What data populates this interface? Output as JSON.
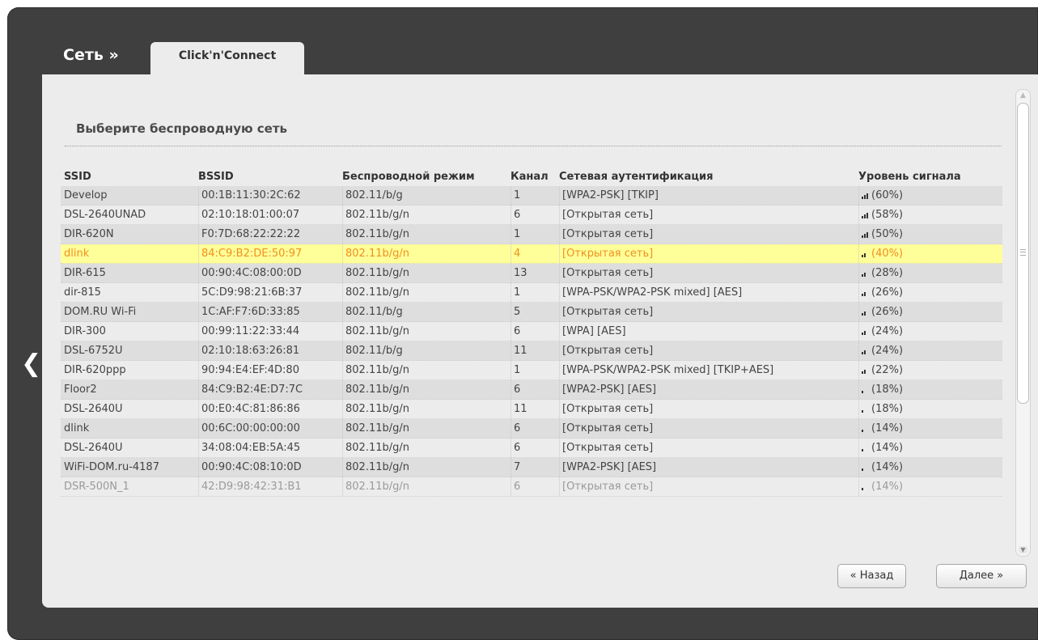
{
  "header": {
    "section": "Сеть »",
    "tab": "Click'n'Connect"
  },
  "nav": {
    "back_arrow": "❮"
  },
  "content": {
    "title": "Выберите беспроводную сеть"
  },
  "table": {
    "columns": [
      "SSID",
      "BSSID",
      "Беспроводной режим",
      "Канал",
      "Сетевая аутентификация",
      "Уровень сигнала"
    ],
    "rows": [
      {
        "ssid": "Develop",
        "bssid": "00:1B:11:30:2C:62",
        "mode": "802.11/b/g",
        "channel": "1",
        "auth": "[WPA2-PSK] [TKIP]",
        "signal": "(60%)",
        "bars": 3
      },
      {
        "ssid": "DSL-2640UNAD",
        "bssid": "02:10:18:01:00:07",
        "mode": "802.11b/g/n",
        "channel": "6",
        "auth": "[Открытая сеть]",
        "signal": "(58%)",
        "bars": 3
      },
      {
        "ssid": "DIR-620N",
        "bssid": "F0:7D:68:22:22:22",
        "mode": "802.11b/g/n",
        "channel": "1",
        "auth": "[Открытая сеть]",
        "signal": "(50%)",
        "bars": 3
      },
      {
        "ssid": "dlink",
        "bssid": "84:C9:B2:DE:50:97",
        "mode": "802.11b/g/n",
        "channel": "4",
        "auth": "[Открытая сеть]",
        "signal": "(40%)",
        "bars": 2,
        "selected": true
      },
      {
        "ssid": "DIR-615",
        "bssid": "00:90:4C:08:00:0D",
        "mode": "802.11b/g/n",
        "channel": "13",
        "auth": "[Открытая сеть]",
        "signal": "(28%)",
        "bars": 2
      },
      {
        "ssid": "dir-815",
        "bssid": "5C:D9:98:21:6B:37",
        "mode": "802.11b/g/n",
        "channel": "1",
        "auth": "[WPA-PSK/WPA2-PSK mixed] [AES]",
        "signal": "(26%)",
        "bars": 2
      },
      {
        "ssid": "DOM.RU Wi-Fi",
        "bssid": "1C:AF:F7:6D:33:85",
        "mode": "802.11/b/g",
        "channel": "5",
        "auth": "[Открытая сеть]",
        "signal": "(26%)",
        "bars": 2
      },
      {
        "ssid": "DIR-300",
        "bssid": "00:99:11:22:33:44",
        "mode": "802.11b/g/n",
        "channel": "6",
        "auth": "[WPA] [AES]",
        "signal": "(24%)",
        "bars": 2
      },
      {
        "ssid": "DSL-6752U",
        "bssid": "02:10:18:63:26:81",
        "mode": "802.11/b/g",
        "channel": "11",
        "auth": "[Открытая сеть]",
        "signal": "(24%)",
        "bars": 2
      },
      {
        "ssid": "DIR-620ppp",
        "bssid": "90:94:E4:EF:4D:80",
        "mode": "802.11b/g/n",
        "channel": "1",
        "auth": "[WPA-PSK/WPA2-PSK mixed] [TKIP+AES]",
        "signal": "(22%)",
        "bars": 2
      },
      {
        "ssid": "Floor2",
        "bssid": "84:C9:B2:4E:D7:7C",
        "mode": "802.11b/g/n",
        "channel": "6",
        "auth": "[WPA2-PSK] [AES]",
        "signal": "(18%)",
        "bars": 1
      },
      {
        "ssid": "DSL-2640U",
        "bssid": "00:E0:4C:81:86:86",
        "mode": "802.11b/g/n",
        "channel": "11",
        "auth": "[Открытая сеть]",
        "signal": "(18%)",
        "bars": 1
      },
      {
        "ssid": "dlink",
        "bssid": "00:6C:00:00:00:00",
        "mode": "802.11b/g/n",
        "channel": "6",
        "auth": "[Открытая сеть]",
        "signal": "(14%)",
        "bars": 1
      },
      {
        "ssid": "DSL-2640U",
        "bssid": "34:08:04:EB:5A:45",
        "mode": "802.11b/g/n",
        "channel": "6",
        "auth": "[Открытая сеть]",
        "signal": "(14%)",
        "bars": 1
      },
      {
        "ssid": "WiFi-DOM.ru-4187",
        "bssid": "00:90:4C:08:10:0D",
        "mode": "802.11b/g/n",
        "channel": "7",
        "auth": "[WPA2-PSK] [AES]",
        "signal": "(14%)",
        "bars": 1
      },
      {
        "ssid": "DSR-500N_1",
        "bssid": "42:D9:98:42:31:B1",
        "mode": "802.11b/g/n",
        "channel": "6",
        "auth": "[Открытая сеть]",
        "signal": "(14%)",
        "bars": 1,
        "faded": true
      }
    ]
  },
  "buttons": {
    "back": "« Назад",
    "next": "Далее »"
  },
  "colors": {
    "frame": "#3f3f3f",
    "panel": "#ececec",
    "selected_bg": "#ffff99",
    "selected_text": "#f09020"
  }
}
